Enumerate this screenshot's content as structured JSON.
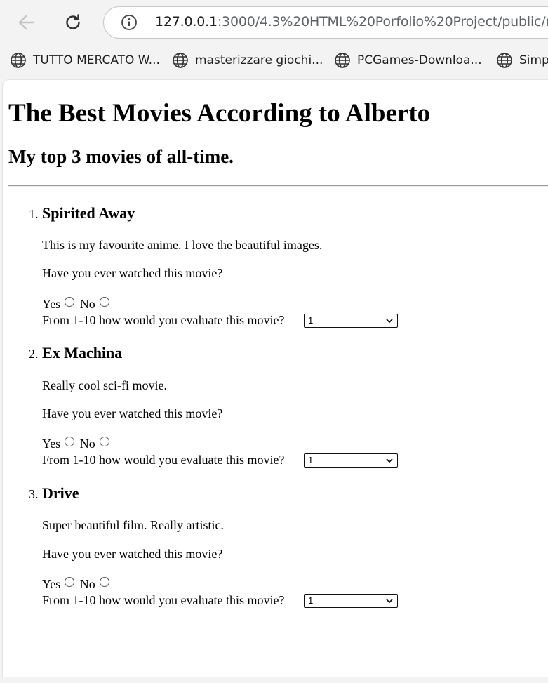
{
  "browser": {
    "url_host": "127.0.0.1",
    "url_path": ":3000/4.3%20HTML%20Porfolio%20Project/public/m",
    "bookmarks": [
      {
        "label": "TUTTO MERCATO W..."
      },
      {
        "label": "masterizzare giochi..."
      },
      {
        "label": "PCGames-Downloa..."
      },
      {
        "label": "Simp"
      }
    ]
  },
  "page": {
    "heading": "The Best Movies According to Alberto",
    "subheading": "My top 3 movies of all-time.",
    "movies": [
      {
        "number": "1.",
        "title": "Spirited Away",
        "description": "This is my favourite anime. I love the beautiful images.",
        "question": "Have you ever watched this movie?",
        "yes_label": "Yes",
        "no_label": "No",
        "rating_prompt": "From 1-10 how would you evaluate this movie?",
        "rating_value": "1"
      },
      {
        "number": "2.",
        "title": "Ex Machina",
        "description": "Really cool sci-fi movie.",
        "question": "Have you ever watched this movie?",
        "yes_label": "Yes",
        "no_label": "No",
        "rating_prompt": "From 1-10 how would you evaluate this movie?",
        "rating_value": "1"
      },
      {
        "number": "3.",
        "title": "Drive",
        "description": "Super beautiful film. Really artistic.",
        "question": "Have you ever watched this movie?",
        "yes_label": "Yes",
        "no_label": "No",
        "rating_prompt": "From 1-10 how would you evaluate this movie?",
        "rating_value": "1"
      }
    ]
  },
  "icons": {
    "back": "arrow-left-icon",
    "reload": "reload-icon",
    "info": "info-icon",
    "bookmark": "globe-icon",
    "select": "chevron-down-icon"
  },
  "colors": {
    "chrome_bg": "#f3f3f3",
    "page_bg": "#ffffff",
    "text": "#000000"
  }
}
